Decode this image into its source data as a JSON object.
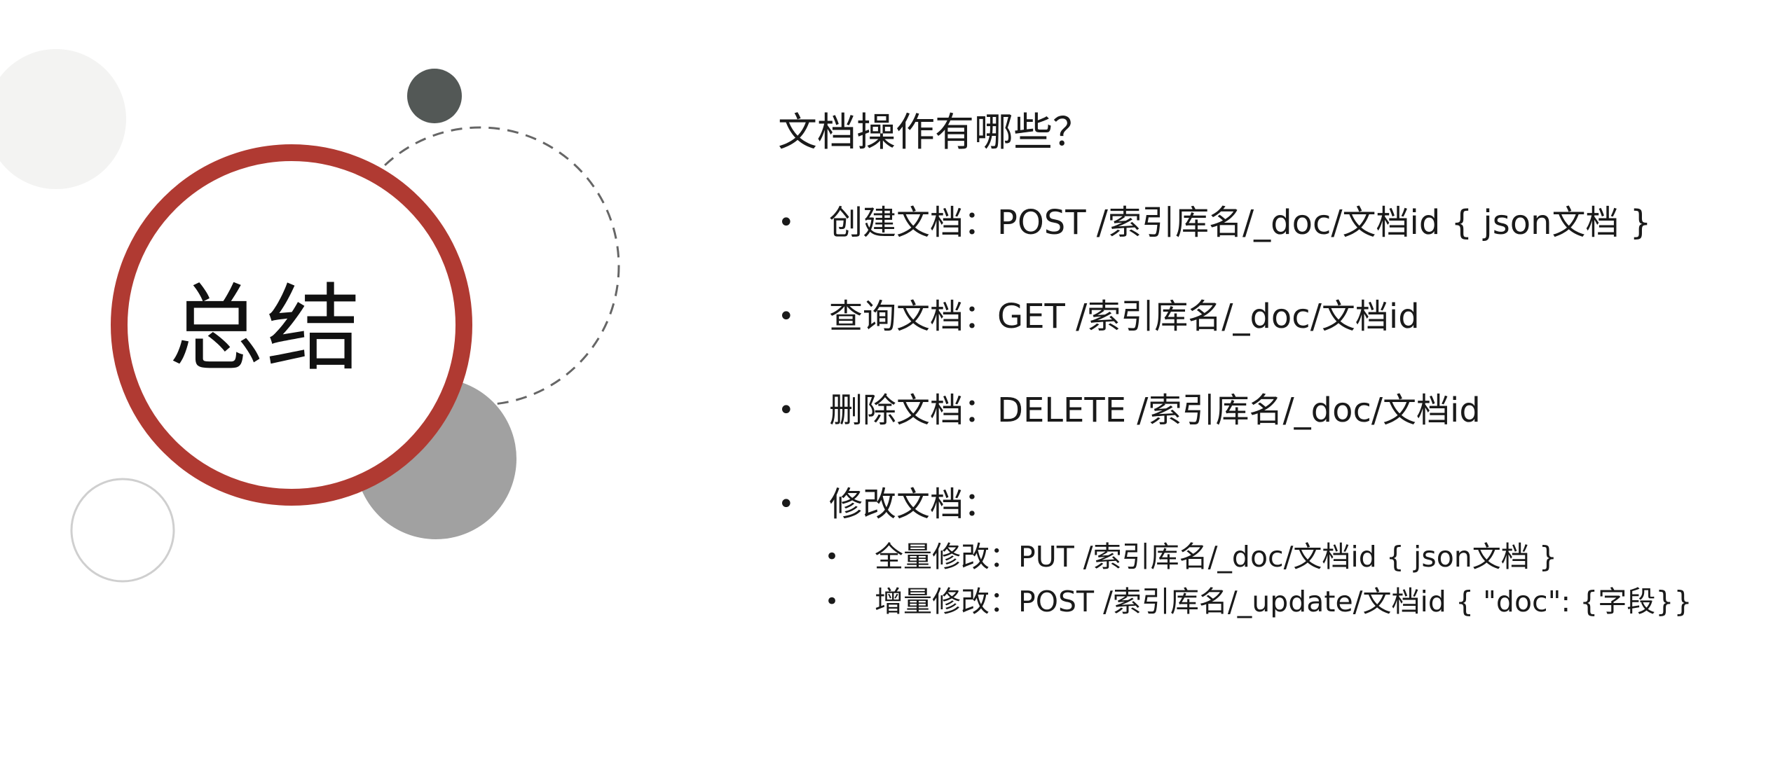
{
  "slide": {
    "title": "总结",
    "question": "文档操作有哪些？",
    "bullet": "•",
    "items": [
      {
        "label": "创建文档：",
        "text": "POST /索引库名/_doc/文档id  { json文档 }"
      },
      {
        "label": "查询文档：",
        "text": "GET /索引库名/_doc/文档id"
      },
      {
        "label": "删除文档：",
        "text": "DELETE /索引库名/_doc/文档id"
      },
      {
        "label": "修改文档：",
        "text": ""
      }
    ],
    "subitems": [
      {
        "label": "全量修改：",
        "text": "PUT /索引库名/_doc/文档id { json文档 }"
      },
      {
        "label": "增量修改：",
        "text": "POST /索引库名/_update/文档id { \"doc\": {字段}}"
      }
    ]
  },
  "colors": {
    "ring_red": "#b03a32",
    "dark_dot": "#535856",
    "mid_gray": "#a1a1a1",
    "light_gray": "#f3f3f2",
    "outline_gray": "#cfcfcf",
    "dash_gray": "#666666"
  }
}
